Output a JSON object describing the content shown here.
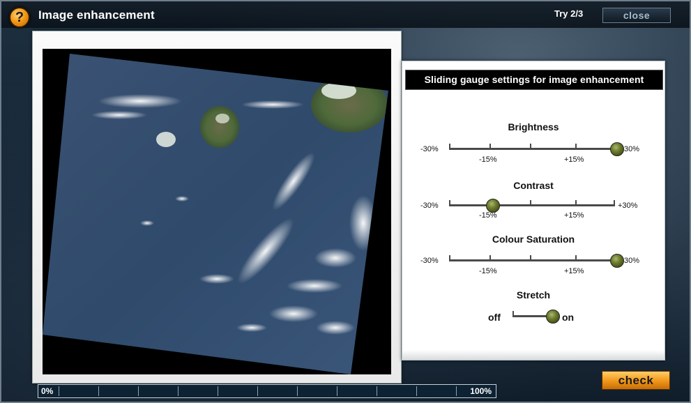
{
  "window": {
    "title": "Image enhancement",
    "try_label": "Try 2/3",
    "close_label": "close",
    "help_label": "?"
  },
  "settings": {
    "header": "Sliding gauge settings for image enhancement",
    "gauges": [
      {
        "title": "Brightness",
        "left_label": "-30%",
        "right_label": "30%",
        "mark_minus": "-15%",
        "mark_plus": "+15%",
        "value": 0.95
      },
      {
        "title": "Contrast",
        "left_label": "-30%",
        "right_label": "+30%",
        "mark_minus": "-15%",
        "mark_plus": "+15%",
        "value": 0.28
      },
      {
        "title": "Colour Saturation",
        "left_label": "-30%",
        "right_label": "30%",
        "mark_minus": "-15%",
        "mark_plus": "+15%",
        "value": 0.95
      }
    ],
    "stretch": {
      "title": "Stretch",
      "off_label": "off",
      "on_label": "on",
      "state": "on"
    }
  },
  "progress": {
    "start_label": "0%",
    "end_label": "100%",
    "value": 0
  },
  "actions": {
    "check_label": "check"
  },
  "colors": {
    "accent_orange": "#f39a1d",
    "knob_green": "#6b7a2c",
    "panel_dark": "#0d2233"
  }
}
